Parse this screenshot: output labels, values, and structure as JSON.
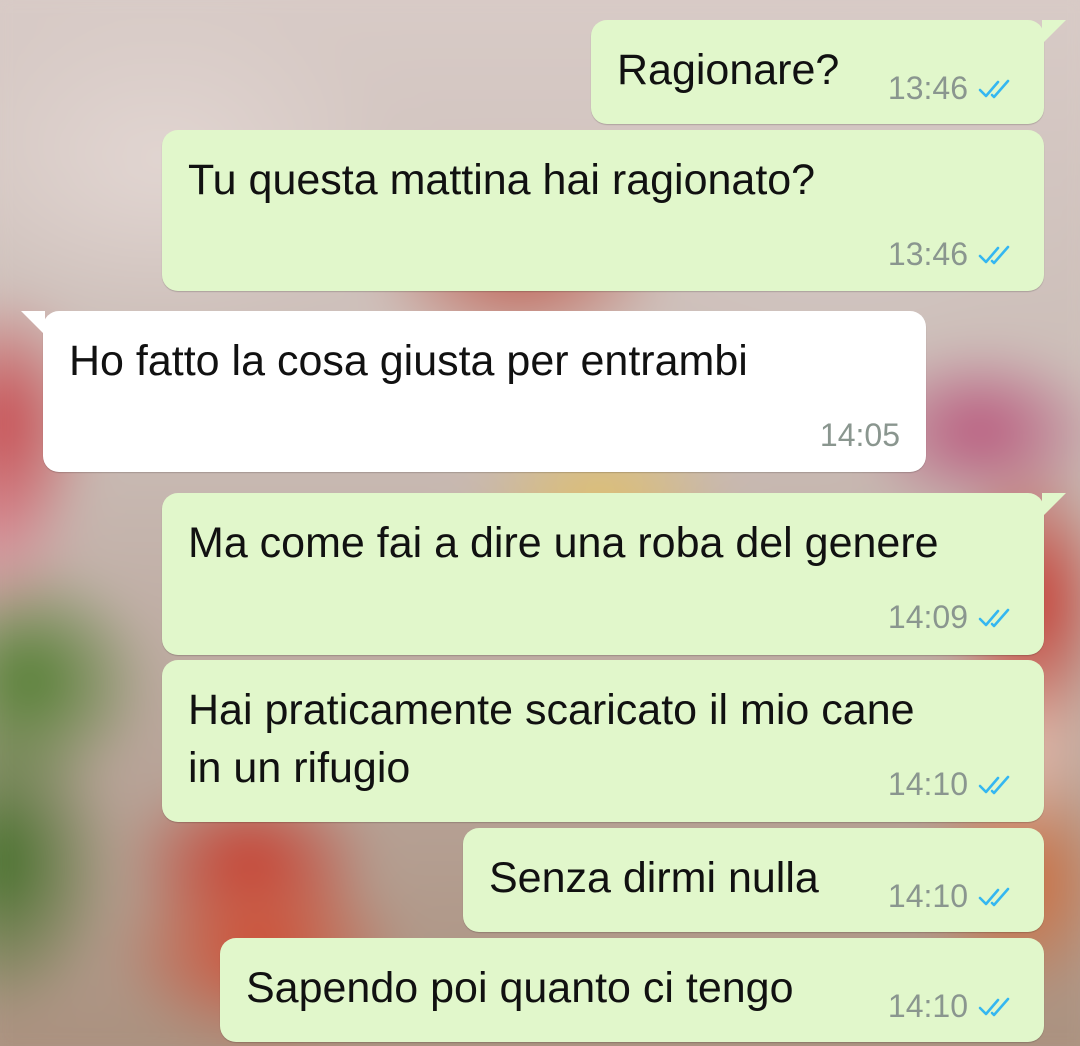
{
  "wallpaper": {
    "description_icon": "floral-wallpaper"
  },
  "colors": {
    "outgoing_bubble": "#e1f7cb",
    "incoming_bubble": "#ffffff",
    "read_ticks": "#34b7f1",
    "meta_text": "#8a968f"
  },
  "messages": [
    {
      "direction": "outgoing",
      "lines": [
        "Ragionare?"
      ],
      "time": "13:46",
      "status": "read-double-tick-icon"
    },
    {
      "direction": "outgoing",
      "lines": [
        "Tu questa mattina hai ragionato?"
      ],
      "time": "13:46",
      "status": "read-double-tick-icon"
    },
    {
      "direction": "incoming",
      "lines": [
        "Ho fatto la cosa giusta per entrambi"
      ],
      "time": "14:05"
    },
    {
      "direction": "outgoing",
      "lines": [
        "Ma come fai a dire una roba del genere"
      ],
      "time": "14:09",
      "status": "read-double-tick-icon"
    },
    {
      "direction": "outgoing",
      "lines": [
        "Hai praticamente scaricato il mio cane",
        "in un rifugio"
      ],
      "time": "14:10",
      "status": "read-double-tick-icon"
    },
    {
      "direction": "outgoing",
      "lines": [
        "Senza dirmi nulla"
      ],
      "time": "14:10",
      "status": "read-double-tick-icon"
    },
    {
      "direction": "outgoing",
      "lines": [
        "Sapendo poi quanto ci tengo"
      ],
      "time": "14:10",
      "status": "read-double-tick-icon"
    }
  ]
}
